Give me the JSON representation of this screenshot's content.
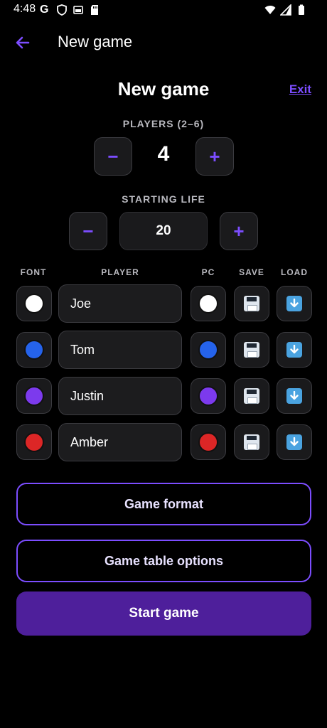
{
  "status_bar": {
    "time": "4:48",
    "icons_left": [
      "google-g-icon",
      "shield-icon",
      "sim-card-icon",
      "sd-card-icon"
    ],
    "icons_right": [
      "wifi-icon",
      "signal-icon",
      "battery-icon"
    ]
  },
  "app_bar": {
    "title": "New game"
  },
  "header": {
    "title": "New game",
    "exit_label": "Exit"
  },
  "players": {
    "label": "PLAYERS (2–6)",
    "value": "4",
    "decrement": "−",
    "increment": "+"
  },
  "life": {
    "label": "STARTING LIFE",
    "value": "20",
    "decrement": "−",
    "increment": "+"
  },
  "columns": {
    "font": "FONT",
    "player": "PLAYER",
    "pc": "PC",
    "save": "SAVE",
    "load": "LOAD"
  },
  "rows": [
    {
      "name": "Joe",
      "font_color": "#ffffff",
      "pc_color": "#ffffff"
    },
    {
      "name": "Tom",
      "font_color": "#2563eb",
      "pc_color": "#2563eb"
    },
    {
      "name": "Justin",
      "font_color": "#7c3aed",
      "pc_color": "#7c3aed"
    },
    {
      "name": "Amber",
      "font_color": "#dc2626",
      "pc_color": "#dc2626"
    }
  ],
  "buttons": {
    "game_format": "Game format",
    "table_options": "Game table options",
    "start": "Start game"
  },
  "colors": {
    "accent": "#7c4dff",
    "primary": "#4e1f9b",
    "background": "#000000"
  }
}
